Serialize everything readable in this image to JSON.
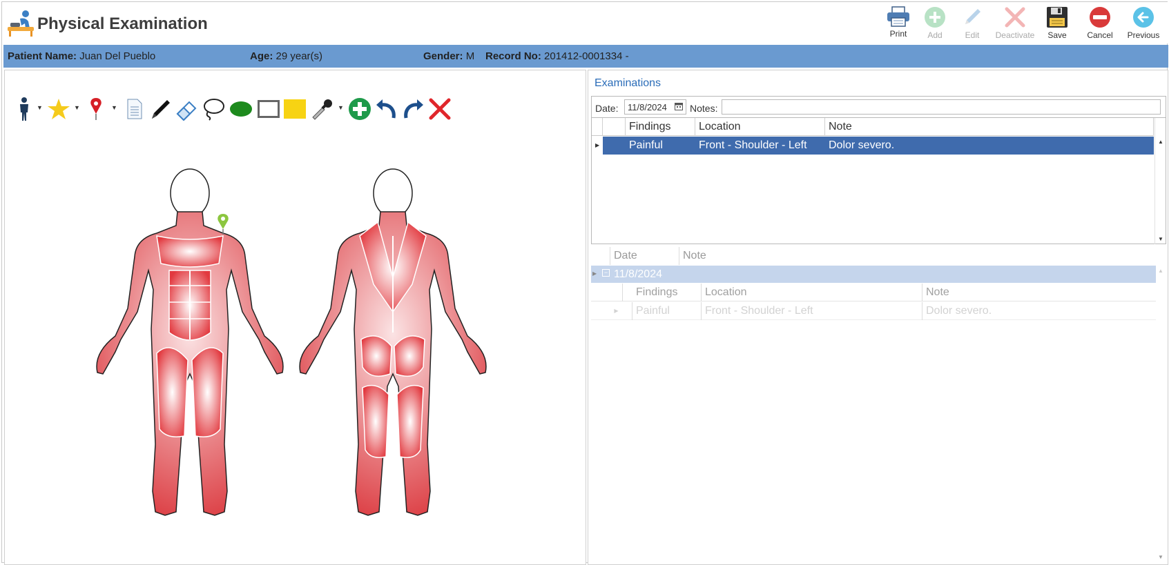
{
  "app": {
    "title": "Physical Examination",
    "accent": "#2a6cb8",
    "bar_color": "#6a9ad0"
  },
  "toolbar": {
    "print": "Print",
    "add": "Add",
    "edit": "Edit",
    "deactivate": "Deactivate",
    "save": "Save",
    "cancel": "Cancel",
    "previous": "Previous"
  },
  "patient": {
    "name_label": "Patient Name:",
    "name": "Juan Del Pueblo",
    "age_label": "Age:",
    "age": "29 year(s)",
    "gender_label": "Gender:",
    "gender": "M",
    "record_label": "Record No:",
    "record": "201412-0001334 -"
  },
  "drawing_tools": [
    "body-figure-icon",
    "star-icon",
    "map-pin-icon",
    "document-icon",
    "pen-icon",
    "eraser-icon",
    "lasso-icon",
    "ellipse-icon",
    "rectangle-icon",
    "filled-rectangle-icon",
    "eyedropper-icon",
    "add-circle-icon",
    "undo-icon",
    "redo-icon",
    "delete-x-icon"
  ],
  "examinations": {
    "title": "Examinations",
    "date_label": "Date:",
    "date_value": "11/8/2024",
    "notes_label": "Notes:",
    "notes_value": "",
    "columns": [
      "Findings",
      "Location",
      "Note"
    ],
    "rows": [
      {
        "findings": "Painful",
        "location": "Front - Shoulder - Left",
        "note": "Dolor severo."
      }
    ]
  },
  "history": {
    "columns": [
      "Date",
      "Note"
    ],
    "group_date": "11/8/2024",
    "sub_columns": [
      "Findings",
      "Location",
      "Note"
    ],
    "sub_rows": [
      {
        "findings": "Painful",
        "location": "Front - Shoulder - Left",
        "note": "Dolor severo."
      }
    ]
  }
}
